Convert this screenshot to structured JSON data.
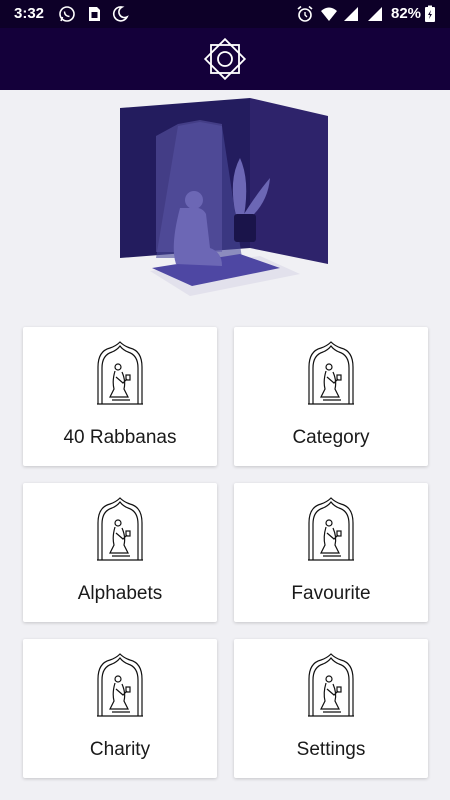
{
  "status_bar": {
    "time": "3:32",
    "battery": "82%",
    "icons": [
      "whatsapp-icon",
      "sim-icon",
      "moon-icon",
      "alarm-icon",
      "wifi-icon",
      "signal-icon",
      "signal-icon",
      "battery-charging-icon"
    ]
  },
  "app_bar": {
    "logo": "eight-point-star-icon",
    "color": "#14003a"
  },
  "hero": {
    "image": "prayer-room-illustration",
    "color": "#2e236b"
  },
  "menu": {
    "items": [
      {
        "label": "40 Rabbanas",
        "icon": "praying-arch-icon"
      },
      {
        "label": "Category",
        "icon": "praying-arch-icon"
      },
      {
        "label": "Alphabets",
        "icon": "praying-arch-icon"
      },
      {
        "label": "Favourite",
        "icon": "praying-arch-icon"
      },
      {
        "label": "Charity",
        "icon": "praying-arch-icon"
      },
      {
        "label": "Settings",
        "icon": "praying-arch-icon"
      }
    ]
  }
}
